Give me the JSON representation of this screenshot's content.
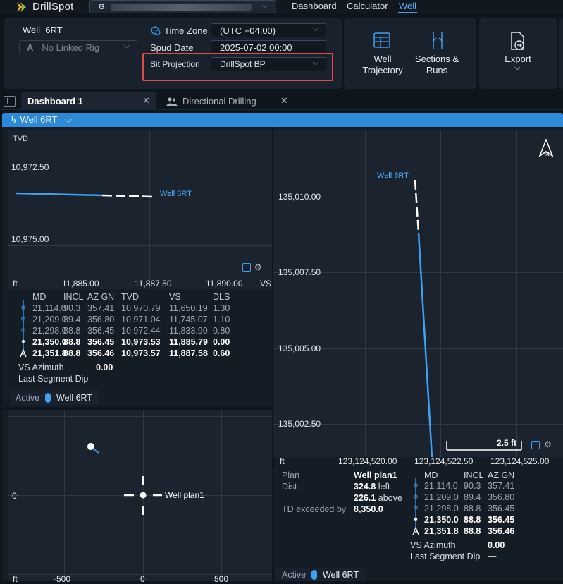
{
  "app": {
    "name": "DrillSpot",
    "account_prefix": "G"
  },
  "nav": {
    "dashboard": "Dashboard",
    "calculator": "Calculator",
    "well": "Well"
  },
  "header": {
    "well_label": "Well",
    "well_name": "6RT",
    "rig_placeholder": "No Linked Rig",
    "time_zone_label": "Time Zone",
    "time_zone_value": "(UTC +04:00)",
    "spud_label": "Spud Date",
    "spud_value": "2025-07-02 00:00",
    "bit_projection_label": "Bit Projection",
    "bit_projection_value": "DrillSpot BP",
    "well_trajectory": "Well Trajectory",
    "sections_runs": "Sections & Runs",
    "export": "Export"
  },
  "tabs": [
    {
      "label": "Dashboard 1"
    },
    {
      "label": "Directional Drilling"
    }
  ],
  "well_selector": "Well 6RT",
  "tvd_plot": {
    "corner_label": "TVD",
    "unit_left": "ft",
    "unit_right": "VS",
    "y_ticks": [
      "10,972.50",
      "10,975.00"
    ],
    "x_ticks": [
      "11,885.00",
      "11,887.50",
      "11,890.00"
    ],
    "series_label": "Well 6RT"
  },
  "plan_plot": {
    "y_ticks": [
      "135,010.00",
      "135,007.50",
      "135,005.00",
      "135,002.50"
    ],
    "x_ticks": [
      "123,124,520.00",
      "123,124,522.50",
      "123,124,525.00"
    ],
    "unit": "ft",
    "series_label": "Well 6RT",
    "scale_label": "2.5 ft",
    "north": "N"
  },
  "survey_table_left": {
    "headers": [
      "MD",
      "INCL",
      "AZ GN",
      "TVD",
      "VS",
      "DLS"
    ],
    "rows": [
      [
        "21,114.0",
        "90.3",
        "357.41",
        "10,970.79",
        "11,650.19",
        "1.30"
      ],
      [
        "21,209.0",
        "89.4",
        "356.80",
        "10,971.04",
        "11,745.07",
        "1.10"
      ],
      [
        "21,298.0",
        "88.8",
        "356.45",
        "10,972.44",
        "11,833.90",
        "0.80"
      ],
      [
        "21,350.0",
        "88.8",
        "356.45",
        "10,973.53",
        "11,885.79",
        "0.00"
      ],
      [
        "21,351.8",
        "88.8",
        "356.46",
        "10,973.57",
        "11,887.58",
        "0.60"
      ]
    ],
    "vs_azimuth_label": "VS Azimuth",
    "vs_azimuth_value": "0.00",
    "last_segment_label": "Last Segment Dip",
    "last_segment_value": "—"
  },
  "active_left": {
    "label": "Active",
    "well": "Well 6RT"
  },
  "anti_collision": {
    "y_tick": "0",
    "x_ticks": [
      "-500",
      "0",
      "500"
    ],
    "unit": "ft",
    "plan_label": "Well plan1"
  },
  "plan_info": {
    "plan_label": "Plan",
    "plan_value": "Well plan1",
    "dist_label": "Dist",
    "dist_left_value": "324.8",
    "dist_left_unit": "left",
    "dist_above_value": "226.1",
    "dist_above_unit": "above",
    "td_label": "TD exceeded by",
    "td_value": "8,350.0"
  },
  "survey_table_right": {
    "headers": [
      "MD",
      "INCL",
      "AZ GN"
    ],
    "rows": [
      [
        "21,114.0",
        "90.3",
        "357.41"
      ],
      [
        "21,209.0",
        "89.4",
        "356.80"
      ],
      [
        "21,298.0",
        "88.8",
        "356.45"
      ],
      [
        "21,350.0",
        "88.8",
        "356.45"
      ],
      [
        "21,351.8",
        "88.8",
        "356.46"
      ]
    ],
    "vs_azimuth_label": "VS Azimuth",
    "vs_azimuth_value": "0.00",
    "last_segment_label": "Last Segment Dip",
    "last_segment_value": "—"
  },
  "active_right": {
    "label": "Active",
    "well": "Well 6RT"
  },
  "colors": {
    "accent": "#3ea0f0",
    "highlight": "#e04a4a",
    "trajectory": "#3ea0f0"
  }
}
